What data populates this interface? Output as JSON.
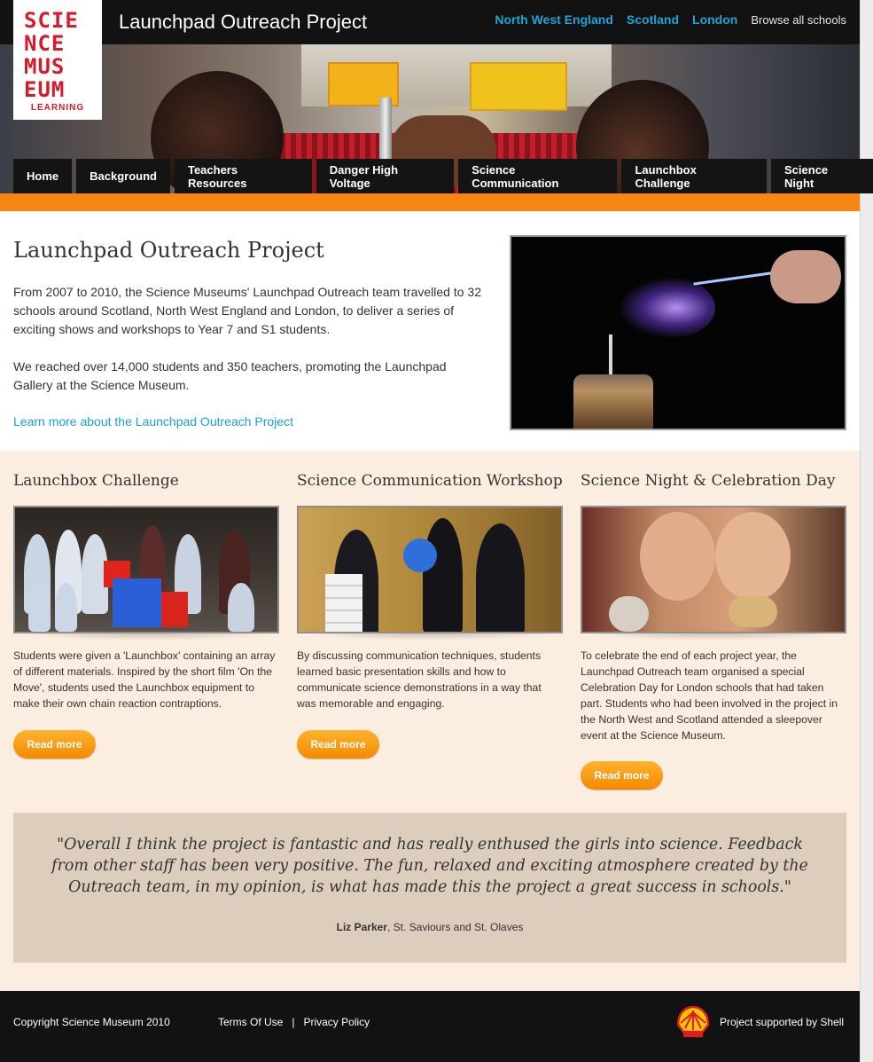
{
  "header": {
    "site_title": "Launchpad Outreach Project",
    "regions": [
      "North West England",
      "Scotland",
      "London"
    ],
    "browse_label": "Browse all schools"
  },
  "logo": {
    "lines": [
      "SCIE",
      "NCE",
      "MUS",
      "EUM"
    ],
    "sub": "LEARNING"
  },
  "nav": {
    "tabs": [
      "Home",
      "Background",
      "Teachers Resources",
      "Danger High Voltage",
      "Science Communication",
      "Launchbox Challenge",
      "Science Night"
    ],
    "active": "Home"
  },
  "intro": {
    "title": "Launchpad Outreach Project",
    "paragraph1": "From 2007 to 2010, the Science Museums' Launchpad Outreach team travelled to 32 schools around Scotland, North West England and London, to deliver a series of exciting shows and workshops to Year 7 and S1 students.",
    "paragraph2": "We reached over 14,000 students and 350 teachers, promoting the Launchpad Gallery at the Science Museum.",
    "learn_more": "Learn more about the Launchpad Outreach Project"
  },
  "features": [
    {
      "title": "Launchbox Challenge",
      "description": "Students were given a 'Launchbox' containing an array of different materials. Inspired by the short film 'On the Move', students used the Launchbox equipment to make their own chain reaction contraptions.",
      "button": "Read more"
    },
    {
      "title": "Science Communication Workshop",
      "description": "By discussing communication techniques, students learned basic presentation skills and how to communicate science demonstrations in a way that was memorable and engaging.",
      "button": "Read more"
    },
    {
      "title": "Science Night & Celebration Day",
      "description": "To celebrate the end of each project year, the Launchpad Outreach team organised a special Celebration Day for London schools that had taken part. Students who had been involved in the project in the North West and Scotland attended a sleepover event at the Science Museum.",
      "button": "Read more"
    }
  ],
  "quote": {
    "text": "\"Overall I think the project is fantastic and has really enthused the girls into science. Feedback from other staff has been very positive. The fun, relaxed and exciting atmosphere created by the Outreach team, in my opinion, is what has made this the project a great success in schools.\"",
    "author": "Liz Parker",
    "affiliation": ", St. Saviours and St. Olaves"
  },
  "footer": {
    "copyright": "Copyright Science Museum 2010",
    "terms": "Terms Of Use",
    "separator": "|",
    "privacy": "Privacy Policy",
    "supported": "Project supported by Shell"
  },
  "colors": {
    "accent_orange": "#f5860f",
    "link_blue": "#1aa0d8",
    "logo_red": "#d8192c",
    "cream_bg": "#fbeddf",
    "quote_bg": "#ddcdbd"
  }
}
